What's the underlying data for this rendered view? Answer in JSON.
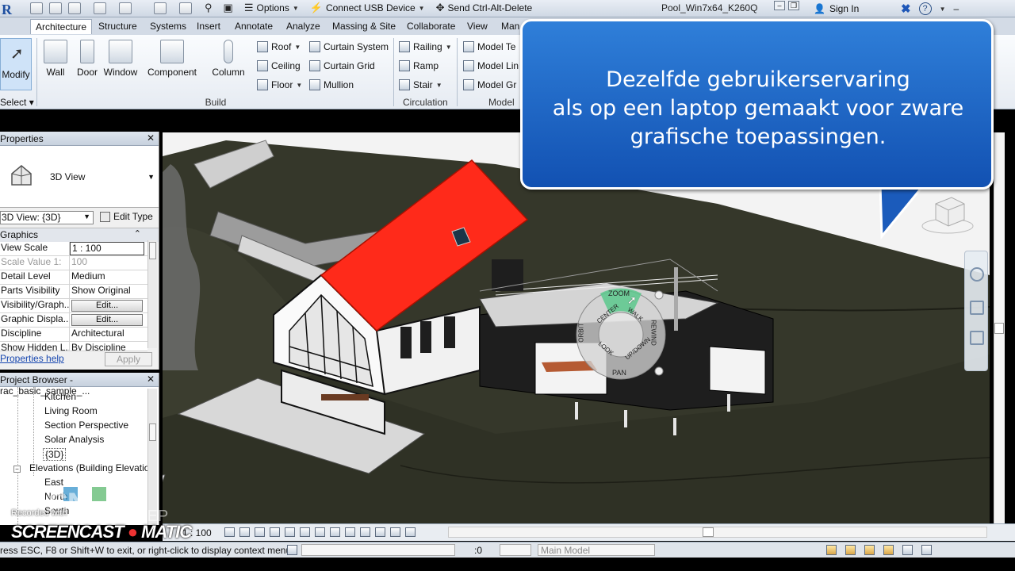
{
  "titlebar": {
    "rdp_options": "Options",
    "rdp_connect_usb": "Connect USB Device",
    "rdp_send_cad": "Send Ctrl-Alt-Delete",
    "window_title": "Pool_Win7x64_K260Q",
    "sign_in": "Sign In"
  },
  "tabs": [
    "Architecture",
    "Structure",
    "Systems",
    "Insert",
    "Annotate",
    "Analyze",
    "Massing & Site",
    "Collaborate",
    "View",
    "Man"
  ],
  "ribbon": {
    "modify": "Modify",
    "select": "Select",
    "big_tools": [
      "Wall",
      "Door",
      "Window",
      "Component",
      "Column"
    ],
    "build_small": [
      "Roof",
      "Ceiling",
      "Floor"
    ],
    "curtain": [
      "Curtain System",
      "Curtain Grid",
      "Mullion"
    ],
    "circulation": [
      "Railing",
      "Ramp",
      "Stair"
    ],
    "model": [
      "Model Te",
      "Model Lin",
      "Model Gr"
    ],
    "panels": {
      "build": "Build",
      "circulation": "Circulation",
      "model": "Model"
    }
  },
  "properties": {
    "title": "Properties",
    "type_name": "3D View",
    "view_selector": "3D View: {3D}",
    "edit_type": "Edit Type",
    "group": "Graphics",
    "rows": [
      {
        "k": "View Scale",
        "v": "1 : 100"
      },
      {
        "k": "Scale Value   1:",
        "v": "100"
      },
      {
        "k": "Detail Level",
        "v": "Medium"
      },
      {
        "k": "Parts Visibility",
        "v": "Show Original"
      },
      {
        "k": "Visibility/Graph...",
        "v": "Edit..."
      },
      {
        "k": "Graphic Displa...",
        "v": "Edit..."
      },
      {
        "k": "Discipline",
        "v": "Architectural"
      },
      {
        "k": "Show Hidden L...",
        "v": "By Discipline"
      }
    ],
    "help": "Properties help",
    "apply": "Apply"
  },
  "browser": {
    "title": "Project Browser - rac_basic_sample_...",
    "items": [
      "Kitchen",
      "Living Room",
      "Section Perspective",
      "Solar Analysis",
      "{3D}",
      "Elevations (Building Elevation",
      "East",
      "North",
      "South"
    ]
  },
  "callout": {
    "lines": [
      "Dezelfde gebruikerservaring",
      "als op een laptop gemaakt voor zware",
      "grafische toepassingen."
    ]
  },
  "wheel": {
    "zoom": "ZOOM",
    "pan": "PAN",
    "walk": "WALK",
    "rewind": "REWIND",
    "orbit": "ORBIT",
    "center": "CENTER",
    "up_down": "UP/DOWN",
    "look": "LOOK"
  },
  "viewbar": {
    "scale": "1 : 100"
  },
  "statusbar": {
    "hint": "ress ESC, F8 or Shift+W to exit, or right-click to display context menu.",
    "zero": ":0",
    "model": "Main Model"
  },
  "watermark": {
    "recorded": "Recorded with",
    "screencast": "SCREENCAST",
    "matic": "MATIC",
    "sn": "SN",
    "groep": "GROEP"
  }
}
